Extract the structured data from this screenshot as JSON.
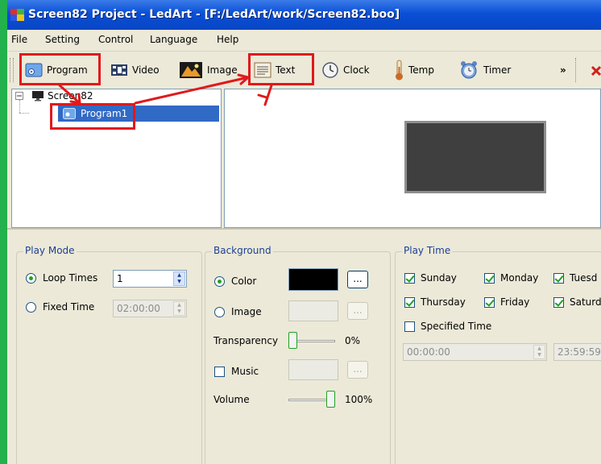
{
  "window": {
    "title": "Screen82 Project - LedArt - [F:/LedArt/work/Screen82.boo]"
  },
  "menu": [
    "File",
    "Setting",
    "Control",
    "Language",
    "Help"
  ],
  "toolbar": {
    "program": "Program",
    "video": "Video",
    "image": "Image",
    "text": "Text",
    "clock": "Clock",
    "temp": "Temp",
    "timer": "Timer",
    "overflow": "»"
  },
  "tree": {
    "root": "Screen82",
    "child": "Program1"
  },
  "play_mode": {
    "title": "Play Mode",
    "loop_label": "Loop Times",
    "loop_value": "1",
    "fixed_label": "Fixed Time",
    "fixed_value": "02:00:00",
    "selected": "loop"
  },
  "background": {
    "title": "Background",
    "color_label": "Color",
    "color_value": "#000000",
    "image_label": "Image",
    "browse": "...",
    "transparency_label": "Transparency",
    "transparency_value": "0%",
    "transparency_level": 0,
    "music_label": "Music",
    "volume_label": "Volume",
    "volume_value": "100%",
    "volume_level": 100
  },
  "play_time": {
    "title": "Play Time",
    "days": [
      "Sunday",
      "Monday",
      "Tuesd",
      "Thursday",
      "Friday",
      "Saturd"
    ],
    "specified_label": "Specified Time",
    "start": "00:00:00",
    "end": "23:59:59"
  },
  "colors": {
    "annotation": "#e0191c",
    "selection": "#316ac5"
  }
}
